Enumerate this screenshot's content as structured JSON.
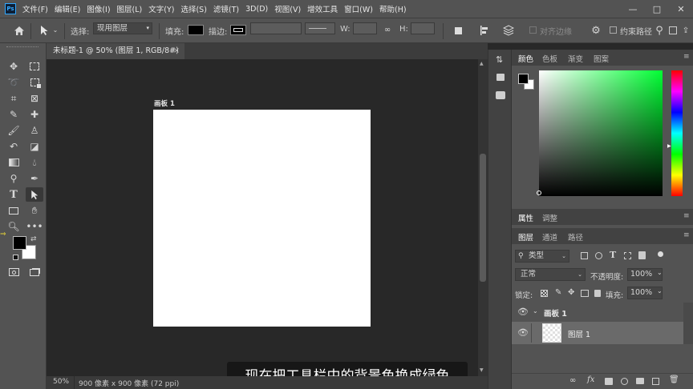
{
  "app": {
    "logo": "Ps"
  },
  "menu": [
    "文件(F)",
    "编辑(E)",
    "图像(I)",
    "图层(L)",
    "文字(Y)",
    "选择(S)",
    "滤镜(T)",
    "3D(D)",
    "视图(V)",
    "增效工具",
    "窗口(W)",
    "帮助(H)"
  ],
  "window_controls": {
    "minimize": "—",
    "maximize": "□",
    "close": "✕"
  },
  "options": {
    "select_label": "选择:",
    "select_value": "现用图层",
    "fill_label": "填充:",
    "stroke_label": "描边:",
    "w_label": "W:",
    "h_label": "H:",
    "align_edges_label": "对齐边缘",
    "constrain_path_label": "约束路径"
  },
  "document": {
    "tab_title": "未标题-1 @ 50% (图层 1, RGB/8#)",
    "tab_close": "×",
    "artboard_label": "画板 1"
  },
  "status": {
    "zoom": "50%",
    "doc_info": "900 像素 x 900 像素 (72 ppi)"
  },
  "caption": "现在把工具栏中的背景色换成绿色",
  "panels": {
    "color_tabs": [
      "颜色",
      "色板",
      "渐变",
      "图案"
    ],
    "props_tabs": [
      "属性",
      "调整"
    ],
    "layers_tabs": [
      "图层",
      "通道",
      "路径"
    ],
    "kind_label": "类型",
    "blend_mode": "正常",
    "opacity_label": "不透明度:",
    "opacity_value": "100%",
    "lock_label": "锁定:",
    "fill_label": "填充:",
    "fill_value": "100%",
    "layers": [
      {
        "name": "画板 1",
        "type": "artboard"
      },
      {
        "name": "图层 1",
        "type": "layer",
        "selected": true
      }
    ]
  },
  "colors": {
    "foreground": "#000000",
    "background": "#ffffff",
    "picker_hue": "#00ff33"
  }
}
